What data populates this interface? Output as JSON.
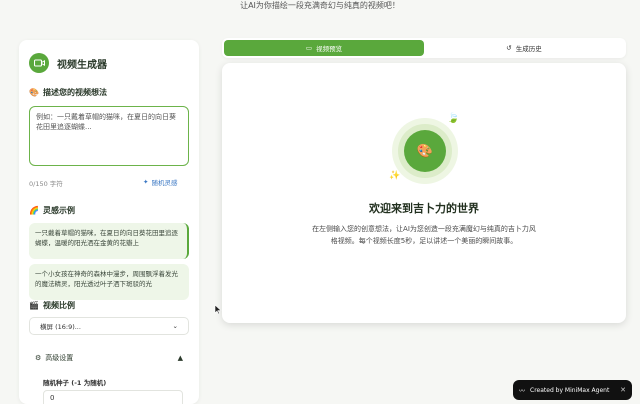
{
  "header": {
    "subtitle": "让AI为你描绘一段充满奇幻与纯真的视频吧！"
  },
  "sidebar": {
    "title": "视频生成器",
    "prompt_label": "描述您的视频想法",
    "prompt_placeholder": "例如：一只戴着草帽的猫咪，在夏日的向日葵花田里追逐蝴蝶...",
    "counter": "0/150 字符",
    "random_label": "随机灵感",
    "examples_label": "灵感示例",
    "examples": [
      "一只戴着草帽的猫咪，在夏日的向日葵花田里追逐蝴蝶，温暖的阳光洒在金黄的花瓣上",
      "一个小女孩在神奇的森林中漫步，周围飘浮着发光的魔法精灵，阳光透过叶子洒下斑驳的光"
    ],
    "ratio_label": "视频比例",
    "ratio_value": "横屏 (16:9)...",
    "advanced_label": "高级设置",
    "seed_label": "随机种子 (-1 为随机)",
    "seed_value": "0"
  },
  "tabs": [
    {
      "label": "视频预览",
      "active": true
    },
    {
      "label": "生成历史",
      "active": false
    }
  ],
  "preview": {
    "welcome": "欢迎来到吉卜力的世界",
    "description": "在左侧输入您的创意想法，让AI为您创造一段充满魔幻与纯真的吉卜力风格视频。每个视频长度5秒，足以讲述一个美丽的瞬间故事。"
  },
  "badge": {
    "label": "Created by MiniMax Agent"
  },
  "colors": {
    "accent": "#5aa83c",
    "link": "#3b78c4"
  }
}
